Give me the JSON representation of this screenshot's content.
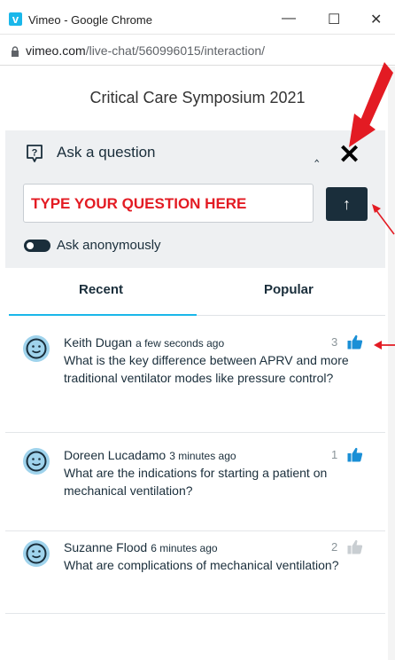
{
  "browser": {
    "window_title": "Vimeo - Google Chrome",
    "url_domain": "vimeo.com",
    "url_path": "/live-chat/560996015/interaction/",
    "controls": [
      "minimize",
      "maximize",
      "close"
    ]
  },
  "event": {
    "title": "Critical Care Symposium 2021"
  },
  "ask": {
    "header_icon": "question-bubble-icon",
    "header_label": "Ask a question",
    "collapse_icon": "caret-up-icon",
    "close_label": "✕",
    "input_value": "TYPE YOUR QUESTION HERE",
    "send_icon": "arrow-up-icon",
    "anonymous_label": "Ask anonymously"
  },
  "tabs": [
    {
      "label": "Recent",
      "active": true
    },
    {
      "label": "Popular",
      "active": false
    }
  ],
  "questions": [
    {
      "author": "Keith Dugan",
      "time": "a few seconds ago",
      "text": "What is the key difference between APRV and more traditional ventilator modes like pressure control?",
      "likes": "3",
      "liked": true
    },
    {
      "author": "Doreen Lucadamo",
      "time": "3 minutes ago",
      "text": "What are the indications for starting a patient on mechanical ventilation?",
      "likes": "1",
      "liked": true
    },
    {
      "author": "Suzanne Flood",
      "time": "6 minutes ago",
      "text": "What are complications of mechanical ventilation?",
      "likes": "2",
      "liked": false
    }
  ],
  "colors": {
    "accent": "#1ab7ea",
    "navy": "#1a2e3b",
    "annotation_red": "#e31b23",
    "panel_bg": "#eef0f2"
  }
}
